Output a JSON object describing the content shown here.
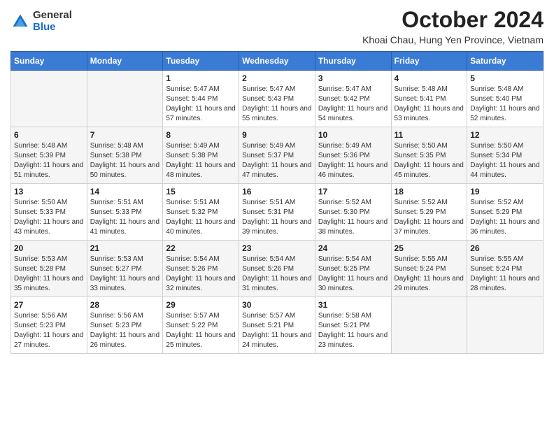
{
  "header": {
    "logo": {
      "general": "General",
      "blue": "Blue"
    },
    "title": "October 2024",
    "location": "Khoai Chau, Hung Yen Province, Vietnam"
  },
  "days_of_week": [
    "Sunday",
    "Monday",
    "Tuesday",
    "Wednesday",
    "Thursday",
    "Friday",
    "Saturday"
  ],
  "weeks": [
    [
      {
        "day": "",
        "info": ""
      },
      {
        "day": "",
        "info": ""
      },
      {
        "day": "1",
        "info": "Sunrise: 5:47 AM\nSunset: 5:44 PM\nDaylight: 11 hours and 57 minutes."
      },
      {
        "day": "2",
        "info": "Sunrise: 5:47 AM\nSunset: 5:43 PM\nDaylight: 11 hours and 55 minutes."
      },
      {
        "day": "3",
        "info": "Sunrise: 5:47 AM\nSunset: 5:42 PM\nDaylight: 11 hours and 54 minutes."
      },
      {
        "day": "4",
        "info": "Sunrise: 5:48 AM\nSunset: 5:41 PM\nDaylight: 11 hours and 53 minutes."
      },
      {
        "day": "5",
        "info": "Sunrise: 5:48 AM\nSunset: 5:40 PM\nDaylight: 11 hours and 52 minutes."
      }
    ],
    [
      {
        "day": "6",
        "info": "Sunrise: 5:48 AM\nSunset: 5:39 PM\nDaylight: 11 hours and 51 minutes."
      },
      {
        "day": "7",
        "info": "Sunrise: 5:48 AM\nSunset: 5:38 PM\nDaylight: 11 hours and 50 minutes."
      },
      {
        "day": "8",
        "info": "Sunrise: 5:49 AM\nSunset: 5:38 PM\nDaylight: 11 hours and 48 minutes."
      },
      {
        "day": "9",
        "info": "Sunrise: 5:49 AM\nSunset: 5:37 PM\nDaylight: 11 hours and 47 minutes."
      },
      {
        "day": "10",
        "info": "Sunrise: 5:49 AM\nSunset: 5:36 PM\nDaylight: 11 hours and 46 minutes."
      },
      {
        "day": "11",
        "info": "Sunrise: 5:50 AM\nSunset: 5:35 PM\nDaylight: 11 hours and 45 minutes."
      },
      {
        "day": "12",
        "info": "Sunrise: 5:50 AM\nSunset: 5:34 PM\nDaylight: 11 hours and 44 minutes."
      }
    ],
    [
      {
        "day": "13",
        "info": "Sunrise: 5:50 AM\nSunset: 5:33 PM\nDaylight: 11 hours and 43 minutes."
      },
      {
        "day": "14",
        "info": "Sunrise: 5:51 AM\nSunset: 5:33 PM\nDaylight: 11 hours and 41 minutes."
      },
      {
        "day": "15",
        "info": "Sunrise: 5:51 AM\nSunset: 5:32 PM\nDaylight: 11 hours and 40 minutes."
      },
      {
        "day": "16",
        "info": "Sunrise: 5:51 AM\nSunset: 5:31 PM\nDaylight: 11 hours and 39 minutes."
      },
      {
        "day": "17",
        "info": "Sunrise: 5:52 AM\nSunset: 5:30 PM\nDaylight: 11 hours and 38 minutes."
      },
      {
        "day": "18",
        "info": "Sunrise: 5:52 AM\nSunset: 5:29 PM\nDaylight: 11 hours and 37 minutes."
      },
      {
        "day": "19",
        "info": "Sunrise: 5:52 AM\nSunset: 5:29 PM\nDaylight: 11 hours and 36 minutes."
      }
    ],
    [
      {
        "day": "20",
        "info": "Sunrise: 5:53 AM\nSunset: 5:28 PM\nDaylight: 11 hours and 35 minutes."
      },
      {
        "day": "21",
        "info": "Sunrise: 5:53 AM\nSunset: 5:27 PM\nDaylight: 11 hours and 33 minutes."
      },
      {
        "day": "22",
        "info": "Sunrise: 5:54 AM\nSunset: 5:26 PM\nDaylight: 11 hours and 32 minutes."
      },
      {
        "day": "23",
        "info": "Sunrise: 5:54 AM\nSunset: 5:26 PM\nDaylight: 11 hours and 31 minutes."
      },
      {
        "day": "24",
        "info": "Sunrise: 5:54 AM\nSunset: 5:25 PM\nDaylight: 11 hours and 30 minutes."
      },
      {
        "day": "25",
        "info": "Sunrise: 5:55 AM\nSunset: 5:24 PM\nDaylight: 11 hours and 29 minutes."
      },
      {
        "day": "26",
        "info": "Sunrise: 5:55 AM\nSunset: 5:24 PM\nDaylight: 11 hours and 28 minutes."
      }
    ],
    [
      {
        "day": "27",
        "info": "Sunrise: 5:56 AM\nSunset: 5:23 PM\nDaylight: 11 hours and 27 minutes."
      },
      {
        "day": "28",
        "info": "Sunrise: 5:56 AM\nSunset: 5:23 PM\nDaylight: 11 hours and 26 minutes."
      },
      {
        "day": "29",
        "info": "Sunrise: 5:57 AM\nSunset: 5:22 PM\nDaylight: 11 hours and 25 minutes."
      },
      {
        "day": "30",
        "info": "Sunrise: 5:57 AM\nSunset: 5:21 PM\nDaylight: 11 hours and 24 minutes."
      },
      {
        "day": "31",
        "info": "Sunrise: 5:58 AM\nSunset: 5:21 PM\nDaylight: 11 hours and 23 minutes."
      },
      {
        "day": "",
        "info": ""
      },
      {
        "day": "",
        "info": ""
      }
    ]
  ]
}
